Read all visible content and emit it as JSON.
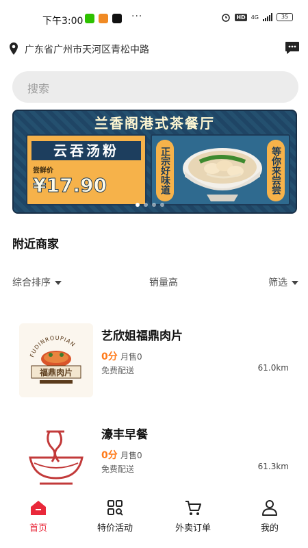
{
  "status_bar": {
    "time": "下午3:00",
    "more": "···",
    "network": "4G",
    "hd": "HD",
    "battery": "35"
  },
  "location": {
    "address": "广东省广州市天河区青松中路"
  },
  "search": {
    "placeholder": "搜索"
  },
  "banner": {
    "title": "兰香阁港式茶餐厅",
    "dish": "云吞汤粉",
    "price_label": "尝鲜价",
    "price": "¥17.90",
    "slogan_left": "正宗好味道",
    "slogan_right": "等你来尝尝",
    "page_count": 4,
    "active_index": 0
  },
  "section": {
    "title": "附近商家"
  },
  "filters": {
    "sort": "综合排序",
    "sales": "销量高",
    "screen": "筛选"
  },
  "merchants": [
    {
      "name": "艺欣姐福鼎肉片",
      "score": "0分",
      "monthly_sales": "月售0",
      "delivery": "免费配送",
      "distance": "61.0km",
      "logo_text": "福鼎肉片",
      "logo_arc": "FUDINROUPIAN"
    },
    {
      "name": "濠丰早餐",
      "score": "0分",
      "monthly_sales": "月售0",
      "delivery": "免费配送",
      "distance": "61.3km"
    }
  ],
  "tabs": [
    {
      "label": "首页",
      "icon": "home-icon",
      "active": true
    },
    {
      "label": "特价活动",
      "icon": "grid-search-icon",
      "active": false
    },
    {
      "label": "外卖订单",
      "icon": "cart-icon",
      "active": false
    },
    {
      "label": "我的",
      "icon": "user-icon",
      "active": false
    }
  ],
  "colors": {
    "accent": "#e9283a",
    "score": "#ff7a1a",
    "banner_bg": "#21496b",
    "banner_card": "#f6b24a"
  }
}
